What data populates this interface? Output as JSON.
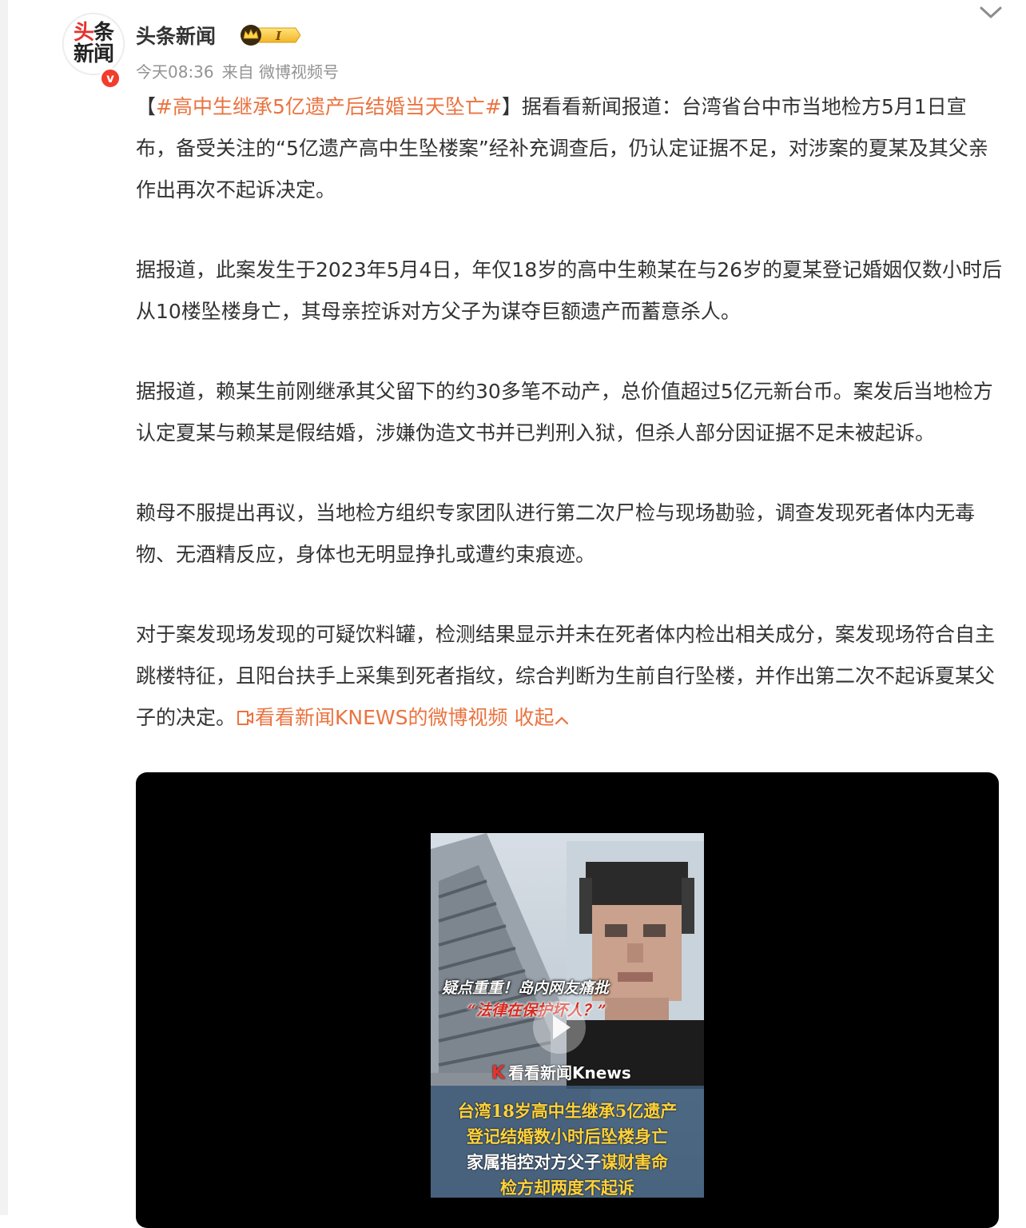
{
  "account": {
    "avatar_line1_a": "头",
    "avatar_line1_b": "条",
    "avatar_line2": "新闻",
    "verified_mark": "v",
    "name": "头条新闻",
    "level_label": "I",
    "time": "今天08:36",
    "source": "来自 微博视频号"
  },
  "post": {
    "open_bracket": "【",
    "hashtag": "#高中生继承5亿遗产后结婚当天坠亡#",
    "p1_rest": "】据看看新闻报道：台湾省台中市当地检方5月1日宣布，备受关注的“5亿遗产高中生坠楼案”经补充调查后，仍认定证据不足，对涉案的夏某及其父亲作出再次不起诉决定。",
    "p2": "据报道，此案发生于2023年5月4日，年仅18岁的高中生赖某在与26岁的夏某登记婚姻仅数小时后从10楼坠楼身亡，其母亲控诉对方父子为谋夺巨额遗产而蓄意杀人。",
    "p3": "据报道，赖某生前刚继承其父留下的约30多笔不动产，总价值超过5亿元新台币。案发后当地检方认定夏某与赖某是假结婚，涉嫌伪造文书并已判刑入狱，但杀人部分因证据不足未被起诉。",
    "p4": "赖母不服提出再议，当地检方组织专家团队进行第二次尸检与现场勘验，调查发现死者体内无毒物、无酒精反应，身体也无明显挣扎或遭约束痕迹。",
    "p5": "对于案发现场发现的可疑饮料罐，检测结果显示并未在死者体内检出相关成分，案发现场符合自主跳楼特征，且阳台扶手上采集到死者指纹，综合判断为生前自行坠楼，并作出第二次不起诉夏某父子的决定。",
    "video_link": "看看新闻KNEWS的微博视频",
    "collapse_label": "收起"
  },
  "video": {
    "overlay_line1": "疑点重重！岛内网友痛批",
    "overlay_line2": "“法律在保护坏人？”",
    "brand_k": "K",
    "brand_text": "看看新闻Knews",
    "caption1": "台湾18岁高中生继承5亿遗产",
    "caption2": "登记结婚数小时后坠楼身亡",
    "caption3_a": "家属指控对方父子",
    "caption3_b": "谋财害命",
    "caption4": "检方却两度不起诉"
  },
  "icons": {
    "chevron": "chevron-down-icon",
    "play": "play-icon",
    "video_link": "video-link-icon"
  },
  "colors": {
    "accent": "#eb7340",
    "verified": "#f23c2c",
    "meta_text": "#939393"
  }
}
